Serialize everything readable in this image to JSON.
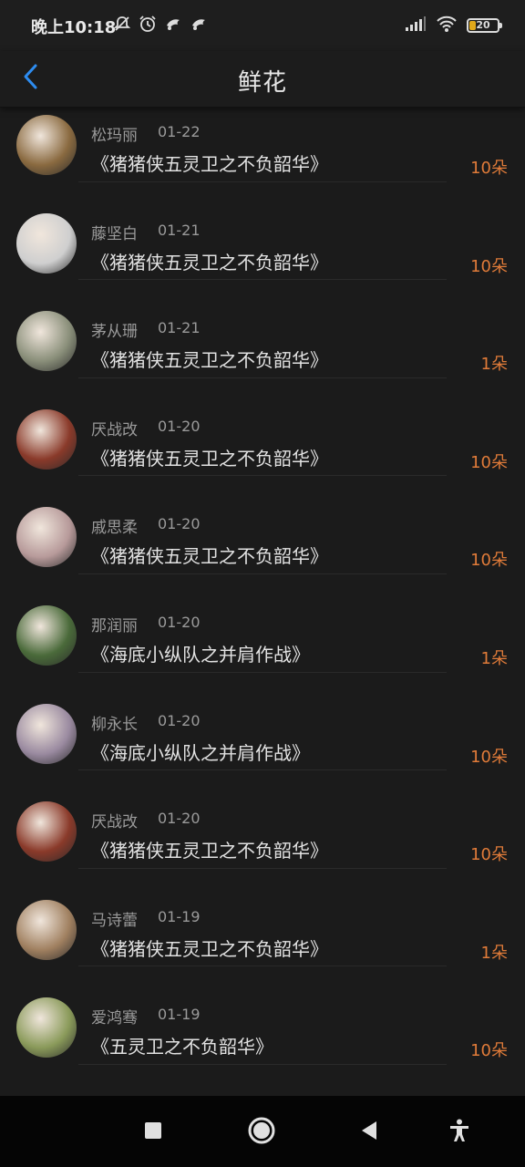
{
  "status_bar": {
    "time": "晚上10:18",
    "icons_left": [
      "mute-icon",
      "alarm-icon",
      "notification-icon",
      "notification-icon"
    ],
    "icons_right": [
      "signal-icon",
      "wifi-icon",
      "battery-icon"
    ],
    "battery_level": "20",
    "battery_color": "#e0a81a"
  },
  "header": {
    "title": "鲜花",
    "back_icon": "chevron-left-icon",
    "accent_color": "#2d8cf0"
  },
  "list": {
    "count_color": "#e07b39",
    "items": [
      {
        "name": "松玛丽",
        "date": "01-22",
        "book": "《猪猪侠五灵卫之不负韶华》",
        "count": "10朵",
        "avatar_color": "#8a6a40"
      },
      {
        "name": "藤坚白",
        "date": "01-21",
        "book": "《猪猪侠五灵卫之不负韶华》",
        "count": "10朵",
        "avatar_color": "#cfcfcf"
      },
      {
        "name": "茅从珊",
        "date": "01-21",
        "book": "《猪猪侠五灵卫之不负韶华》",
        "count": "1朵",
        "avatar_color": "#8a8f7a"
      },
      {
        "name": "厌战改",
        "date": "01-20",
        "book": "《猪猪侠五灵卫之不负韶华》",
        "count": "10朵",
        "avatar_color": "#8a3a2a"
      },
      {
        "name": "戚思柔",
        "date": "01-20",
        "book": "《猪猪侠五灵卫之不负韶华》",
        "count": "10朵",
        "avatar_color": "#b79a9a"
      },
      {
        "name": "那润丽",
        "date": "01-20",
        "book": "《海底小纵队之并肩作战》",
        "count": "1朵",
        "avatar_color": "#4a6a3a"
      },
      {
        "name": "柳永长",
        "date": "01-20",
        "book": "《海底小纵队之并肩作战》",
        "count": "10朵",
        "avatar_color": "#9a8aa0"
      },
      {
        "name": "厌战改",
        "date": "01-20",
        "book": "《猪猪侠五灵卫之不负韶华》",
        "count": "10朵",
        "avatar_color": "#8a3a2a"
      },
      {
        "name": "马诗蕾",
        "date": "01-19",
        "book": "《猪猪侠五灵卫之不负韶华》",
        "count": "1朵",
        "avatar_color": "#a08060"
      },
      {
        "name": "爱鸿骞",
        "date": "01-19",
        "book": "《五灵卫之不负韶华》",
        "count": "10朵",
        "avatar_color": "#8a9a5a"
      }
    ]
  },
  "nav_bar": {
    "buttons": [
      "recent-apps-icon",
      "home-icon",
      "back-triangle-icon",
      "accessibility-icon"
    ]
  }
}
